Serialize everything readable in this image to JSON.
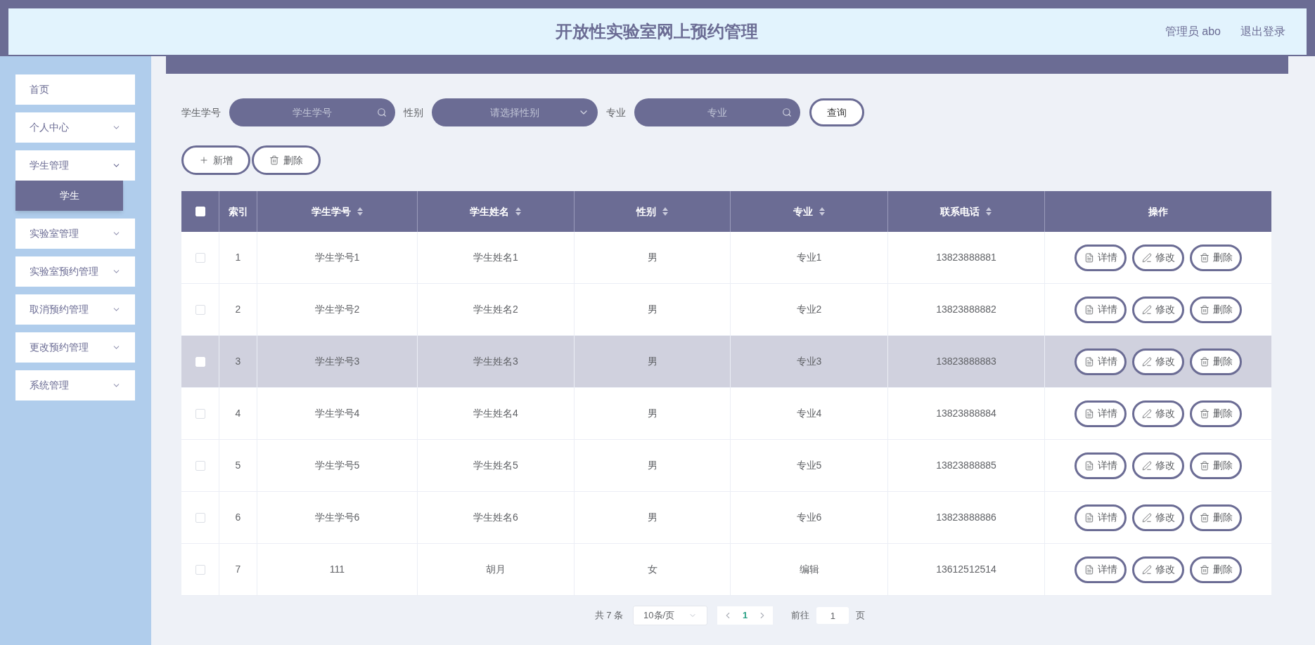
{
  "header": {
    "title": "开放性实验室网上预约管理",
    "user": "管理员 abo",
    "logout": "退出登录"
  },
  "sidebar": {
    "items": [
      {
        "kind": "link",
        "label": "首页"
      },
      {
        "kind": "submenu",
        "label": "个人中心",
        "expanded": false
      },
      {
        "kind": "submenu",
        "label": "学生管理",
        "expanded": true,
        "children": [
          {
            "label": "学生",
            "selected": true
          }
        ]
      },
      {
        "kind": "submenu",
        "label": "实验室管理",
        "expanded": false
      },
      {
        "kind": "submenu",
        "label": "实验室预约管理",
        "expanded": false
      },
      {
        "kind": "submenu",
        "label": "取消预约管理",
        "expanded": false
      },
      {
        "kind": "submenu",
        "label": "更改预约管理",
        "expanded": false
      },
      {
        "kind": "submenu",
        "label": "系统管理",
        "expanded": false
      }
    ]
  },
  "search": {
    "fields": [
      {
        "kind": "input",
        "label": "学生学号",
        "placeholder": "学生学号"
      },
      {
        "kind": "select",
        "label": "性别",
        "placeholder": "请选择性别"
      },
      {
        "kind": "input",
        "label": "专业",
        "placeholder": "专业"
      }
    ],
    "query_button": "查询"
  },
  "actions": [
    {
      "kind": "add",
      "label": "新增"
    },
    {
      "kind": "delete",
      "label": "删除"
    }
  ],
  "table": {
    "select_all_checked": false,
    "columns": [
      {
        "label": "索引",
        "sortable": false
      },
      {
        "label": "学生学号",
        "sortable": true
      },
      {
        "label": "学生姓名",
        "sortable": true
      },
      {
        "label": "性别",
        "sortable": true
      },
      {
        "label": "专业",
        "sortable": true
      },
      {
        "label": "联系电话",
        "sortable": true
      },
      {
        "label": "操作",
        "sortable": false
      }
    ],
    "rows": [
      {
        "checked": false,
        "hovered": false,
        "cells": [
          "1",
          "学生学号1",
          "学生姓名1",
          "男",
          "专业1",
          "13823888881"
        ],
        "actions": [
          {
            "kind": "detail",
            "label": "详情"
          },
          {
            "kind": "edit",
            "label": "修改"
          },
          {
            "kind": "delete",
            "label": "删除"
          }
        ]
      },
      {
        "checked": false,
        "hovered": false,
        "cells": [
          "2",
          "学生学号2",
          "学生姓名2",
          "男",
          "专业2",
          "13823888882"
        ],
        "actions": [
          {
            "kind": "detail",
            "label": "详情"
          },
          {
            "kind": "edit",
            "label": "修改"
          },
          {
            "kind": "delete",
            "label": "删除"
          }
        ]
      },
      {
        "checked": false,
        "hovered": true,
        "cells": [
          "3",
          "学生学号3",
          "学生姓名3",
          "男",
          "专业3",
          "13823888883"
        ],
        "actions": [
          {
            "kind": "detail",
            "label": "详情"
          },
          {
            "kind": "edit",
            "label": "修改"
          },
          {
            "kind": "delete",
            "label": "删除"
          }
        ]
      },
      {
        "checked": false,
        "hovered": false,
        "cells": [
          "4",
          "学生学号4",
          "学生姓名4",
          "男",
          "专业4",
          "13823888884"
        ],
        "actions": [
          {
            "kind": "detail",
            "label": "详情"
          },
          {
            "kind": "edit",
            "label": "修改"
          },
          {
            "kind": "delete",
            "label": "删除"
          }
        ]
      },
      {
        "checked": false,
        "hovered": false,
        "cells": [
          "5",
          "学生学号5",
          "学生姓名5",
          "男",
          "专业5",
          "13823888885"
        ],
        "actions": [
          {
            "kind": "detail",
            "label": "详情"
          },
          {
            "kind": "edit",
            "label": "修改"
          },
          {
            "kind": "delete",
            "label": "删除"
          }
        ]
      },
      {
        "checked": false,
        "hovered": false,
        "cells": [
          "6",
          "学生学号6",
          "学生姓名6",
          "男",
          "专业6",
          "13823888886"
        ],
        "actions": [
          {
            "kind": "detail",
            "label": "详情"
          },
          {
            "kind": "edit",
            "label": "修改"
          },
          {
            "kind": "delete",
            "label": "删除"
          }
        ]
      },
      {
        "checked": false,
        "hovered": false,
        "cells": [
          "7",
          "111",
          "胡月",
          "女",
          "编辑",
          "13612512514"
        ],
        "actions": [
          {
            "kind": "detail",
            "label": "详情"
          },
          {
            "kind": "edit",
            "label": "修改"
          },
          {
            "kind": "delete",
            "label": "删除"
          }
        ]
      }
    ]
  },
  "pagination": {
    "total": "共 7 条",
    "page_size": "10条/页",
    "pages": [
      {
        "label": "1",
        "selected": true
      }
    ],
    "goto_label": "前往",
    "goto_value": "1",
    "page_suffix": "页"
  }
}
